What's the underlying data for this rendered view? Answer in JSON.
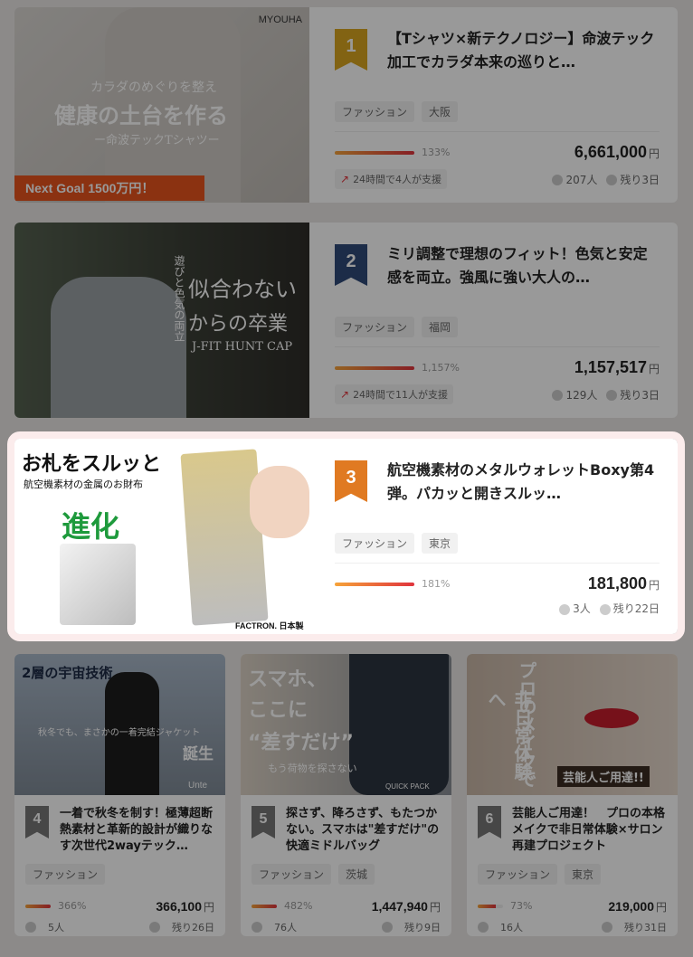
{
  "projects": [
    {
      "rank": "1",
      "title": "【Tシャツ×新テクノロジー】命波テック加工でカラダ本来の巡りと…",
      "tags": [
        "ファッション",
        "大阪"
      ],
      "percent": "133%",
      "progress": 1.0,
      "amount": "6,661,000",
      "currency": "円",
      "trend": "24時間で4人が支援",
      "supporters": "207人",
      "remaining": "残り3日",
      "rank_color": "#d9a51f",
      "img": {
        "brand": "MYOUHA",
        "line1": "カラダのめぐりを整え",
        "line2": "健康の土台を作る",
        "line3": "ー命波テックTシャツー",
        "banner": "Next Goal 1500万円！"
      }
    },
    {
      "rank": "2",
      "title": "ミリ調整で理想のフィット！色気と安定感を両立。強風に強い大人の…",
      "tags": [
        "ファッション",
        "福岡"
      ],
      "percent": "1,157%",
      "progress": 1.0,
      "amount": "1,157,517",
      "currency": "円",
      "trend": "24時間で11人が支援",
      "supporters": "129人",
      "remaining": "残り3日",
      "rank_color": "#2e4a78",
      "img": {
        "line1": "似合わない",
        "line2": "からの卒業",
        "line3": "J-FIT HUNT CAP",
        "vert": "遊びと色気の両立"
      }
    },
    {
      "rank": "3",
      "title": "航空機素材のメタルウォレットBoxy第4弾。パカッと開きスルッ…",
      "tags": [
        "ファッション",
        "東京"
      ],
      "percent": "181%",
      "progress": 1.0,
      "amount": "181,800",
      "currency": "円",
      "supporters": "3人",
      "remaining": "残り22日",
      "rank_color": "#e07a22",
      "img": {
        "line1": "お札をスルッと",
        "line2": "航空機素材の金属のお財布",
        "line3": "進化",
        "brand": "FACTRON. 日本製"
      }
    },
    {
      "rank": "4",
      "title": "一着で秋冬を制す！極薄超断熱素材と革新的設計が織りなす次世代2wayテック…",
      "tags": [
        "ファッション"
      ],
      "percent": "366%",
      "progress": 1.0,
      "amount": "366,100",
      "currency": "円",
      "supporters": "5人",
      "remaining": "残り26日",
      "rank_color": "#777",
      "img": {
        "line1": "2層の宇宙技術",
        "line2": "秋冬でも、まさかの一着完結ジャケット",
        "line3": "誕生",
        "brand": "Unte"
      }
    },
    {
      "rank": "5",
      "title": "探さず、降ろさず、もたつかない。スマホは\"差すだけ\"の快適ミドルバッグ",
      "tags": [
        "ファッション",
        "茨城"
      ],
      "percent": "482%",
      "progress": 1.0,
      "amount": "1,447,940",
      "currency": "円",
      "supporters": "76人",
      "remaining": "残り9日",
      "rank_color": "#777",
      "img": {
        "line1": "スマホ、",
        "line2": "ここに",
        "line3": "“差すだけ”",
        "line4": "もう荷物を探さない",
        "brand": "QUICK PACK"
      }
    },
    {
      "rank": "6",
      "title": "芸能人ご用達！　プロの本格メイクで非日常体験×サロン再建プロジェクト",
      "tags": [
        "ファッション",
        "東京"
      ],
      "percent": "73%",
      "progress": 0.73,
      "amount": "219,000",
      "currency": "円",
      "supporters": "16人",
      "remaining": "残り31日",
      "rank_color": "#777",
      "img": {
        "line1": "プロのメイクで",
        "line2": "非日常体験へ",
        "line3": "芸能人ご用達!!"
      }
    }
  ]
}
